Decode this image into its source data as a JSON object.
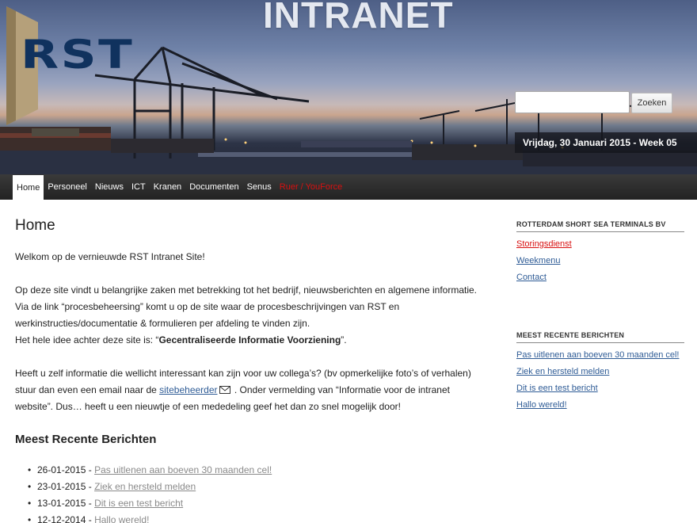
{
  "header": {
    "site_title": "INTRANET",
    "logo_text": "RST",
    "search": {
      "placeholder": "",
      "value": "",
      "button_label": "Zoeken"
    },
    "date_line": "Vrijdag, 30 Januari 2015 - Week 05"
  },
  "nav": {
    "items": [
      {
        "label": "Home",
        "active": true
      },
      {
        "label": "Personeel"
      },
      {
        "label": "Nieuws"
      },
      {
        "label": "ICT"
      },
      {
        "label": "Kranen"
      },
      {
        "label": "Documenten"
      },
      {
        "label": "Senus"
      },
      {
        "label": "Ruer / YouForce",
        "color": "#d81010"
      }
    ]
  },
  "main": {
    "title": "Home",
    "welcome": "Welkom op de vernieuwde RST Intranet Site!",
    "intro_1": "Op deze site vindt u belangrijke zaken met betrekking tot het bedrijf, nieuwsberichten en algemene informatie. Via de link “procesbeheersing” komt u op de site waar de procesbeschrijvingen van RST en werkinstructies/documen­tatie & formulieren per afdeling te vinden zijn.",
    "intro_2_prefix": "Het hele idee achter deze site is: “",
    "intro_2_bold": "Gecentraliseerde Informatie Voorziening",
    "intro_2_suffix": "”.",
    "contact_prefix": "Heeft u zelf informatie die wellicht interessant kan zijn voor uw collega’s? (bv opmerkelijke foto’s of verhalen) stuur dan even een email naar de ",
    "contact_link": "sitebeheerder",
    "contact_suffix": " . Onder vermelding van “Informatie voor de intranet website”. Dus… heeft u een nieuwtje of een mededeling geef het dan zo snel mogelijk door!",
    "recent_title": "Meest Recente Berichten",
    "recent_posts": [
      {
        "date": "26-01-2015",
        "title": "Pas uitlenen aan boeven 30 maanden cel!"
      },
      {
        "date": "23-01-2015",
        "title": "Ziek en hersteld melden"
      },
      {
        "date": "13-01-2015",
        "title": "Dit is een test bericht"
      },
      {
        "date": "12-12-2014",
        "title": "Hallo wereld!"
      }
    ]
  },
  "sidebar": {
    "company_title": "ROTTERDAM SHORT SEA TERMINALS BV",
    "company_links": [
      {
        "label": "Storingsdienst",
        "color": "#d81010"
      },
      {
        "label": "Weekmenu"
      },
      {
        "label": "Contact"
      }
    ],
    "recent_title": "MEEST RECENTE BERICHTEN",
    "recent_links": [
      {
        "label": "Pas uitlenen aan boeven 30 maanden cel!"
      },
      {
        "label": "Ziek en hersteld melden"
      },
      {
        "label": "Dit is een test bericht"
      },
      {
        "label": "Hallo wereld!"
      }
    ]
  },
  "colors": {
    "link": "#2f5c96",
    "alert": "#d81010",
    "nav_bg": "#2a2a2a",
    "logo": "#10325e"
  }
}
